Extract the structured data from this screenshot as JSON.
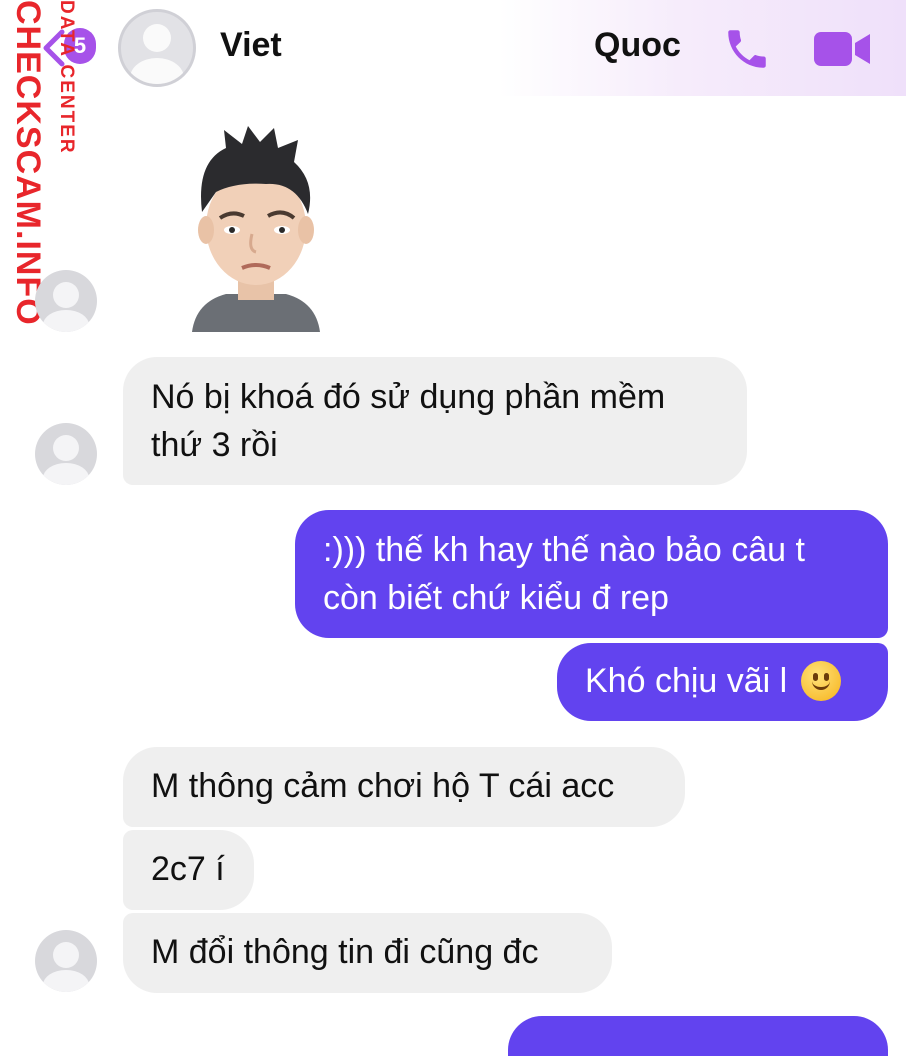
{
  "header": {
    "back_badge": "5",
    "contact_name": "Viet",
    "right_name": "Quoc"
  },
  "watermark": {
    "main": "CHECKSCAM.INFO",
    "sub": "DATA CENTER"
  },
  "colors": {
    "accent": "#a652e9",
    "outgoing_bubble": "#6243ef",
    "incoming_bubble": "#efefef",
    "watermark": "#e8262b"
  },
  "icons": {
    "call": "phone-icon",
    "video": "video-camera-icon",
    "back": "chevron-left-icon"
  },
  "messages": [
    {
      "from": "incoming",
      "lines": [
        "Nó bị khoá đó sử dụng phần mềm",
        "thứ 3 rồi"
      ]
    },
    {
      "from": "outgoing",
      "lines": [
        ":))) thế kh hay thế nào bảo câu t",
        "còn biết chứ kiểu đ rep"
      ]
    },
    {
      "from": "outgoing",
      "text": "Khó chịu vãi l"
    },
    {
      "from": "incoming",
      "text": "M thông cảm chơi hộ T cái acc"
    },
    {
      "from": "incoming",
      "text": "2c7 í"
    },
    {
      "from": "incoming",
      "text": "M đổi thông tin đi cũng đc"
    }
  ]
}
